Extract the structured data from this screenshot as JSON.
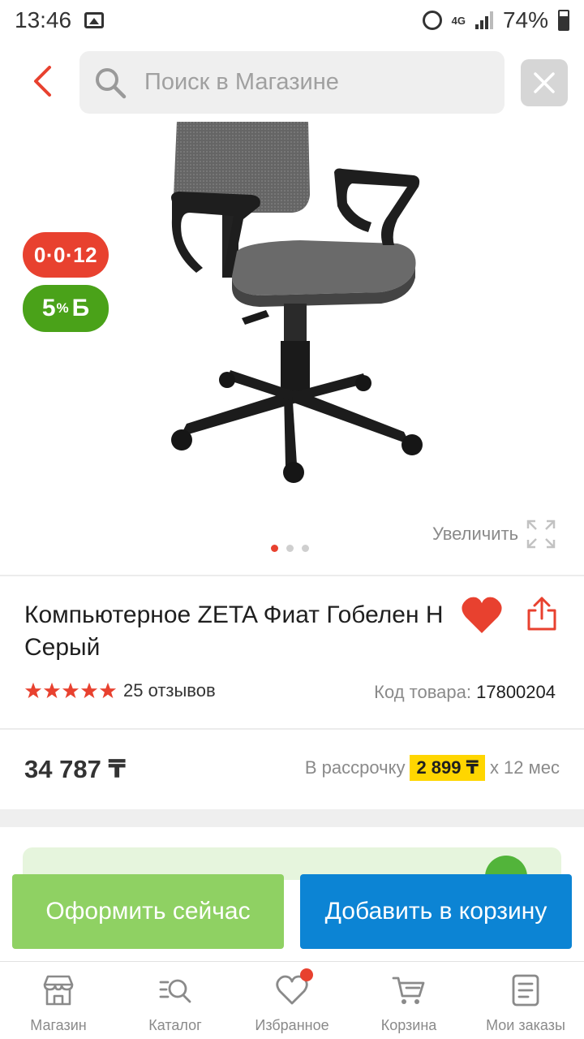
{
  "status_bar": {
    "time": "13:46",
    "network": "4G",
    "battery": "74%"
  },
  "header": {
    "search_placeholder": "Поиск в Магазине"
  },
  "gallery": {
    "badge_credit": "0·0·12",
    "badge_bonus_value": "5",
    "badge_bonus_unit": "%",
    "badge_bonus_letter": "Б",
    "zoom_label": "Увеличить",
    "dots_count": 3,
    "active_dot": 1
  },
  "product": {
    "title": "Компьютерное ZETA Фиат Гобелен Н Серый",
    "rating_stars": 5,
    "reviews": "25 отзывов",
    "sku_label": "Код товара:",
    "sku_value": "17800204",
    "price": "34 787 ₸",
    "installment_label": "В рассрочку",
    "installment_amount": "2 899 ₸",
    "installment_term": "х 12 мес"
  },
  "actions": {
    "buy_now": "Оформить сейчас",
    "add_to_cart": "Добавить в корзину"
  },
  "bottom_nav": [
    {
      "label": "Магазин",
      "icon": "shop-icon"
    },
    {
      "label": "Каталог",
      "icon": "catalog-search-icon"
    },
    {
      "label": "Избранное",
      "icon": "heart-outline-icon"
    },
    {
      "label": "Корзина",
      "icon": "cart-icon"
    },
    {
      "label": "Мои заказы",
      "icon": "orders-icon"
    }
  ],
  "colors": {
    "accent_red": "#e8412f",
    "bonus_green": "#4aa219",
    "buy_green": "#8fd163",
    "cart_blue": "#0c84d4",
    "installment_yellow": "#ffd600"
  }
}
